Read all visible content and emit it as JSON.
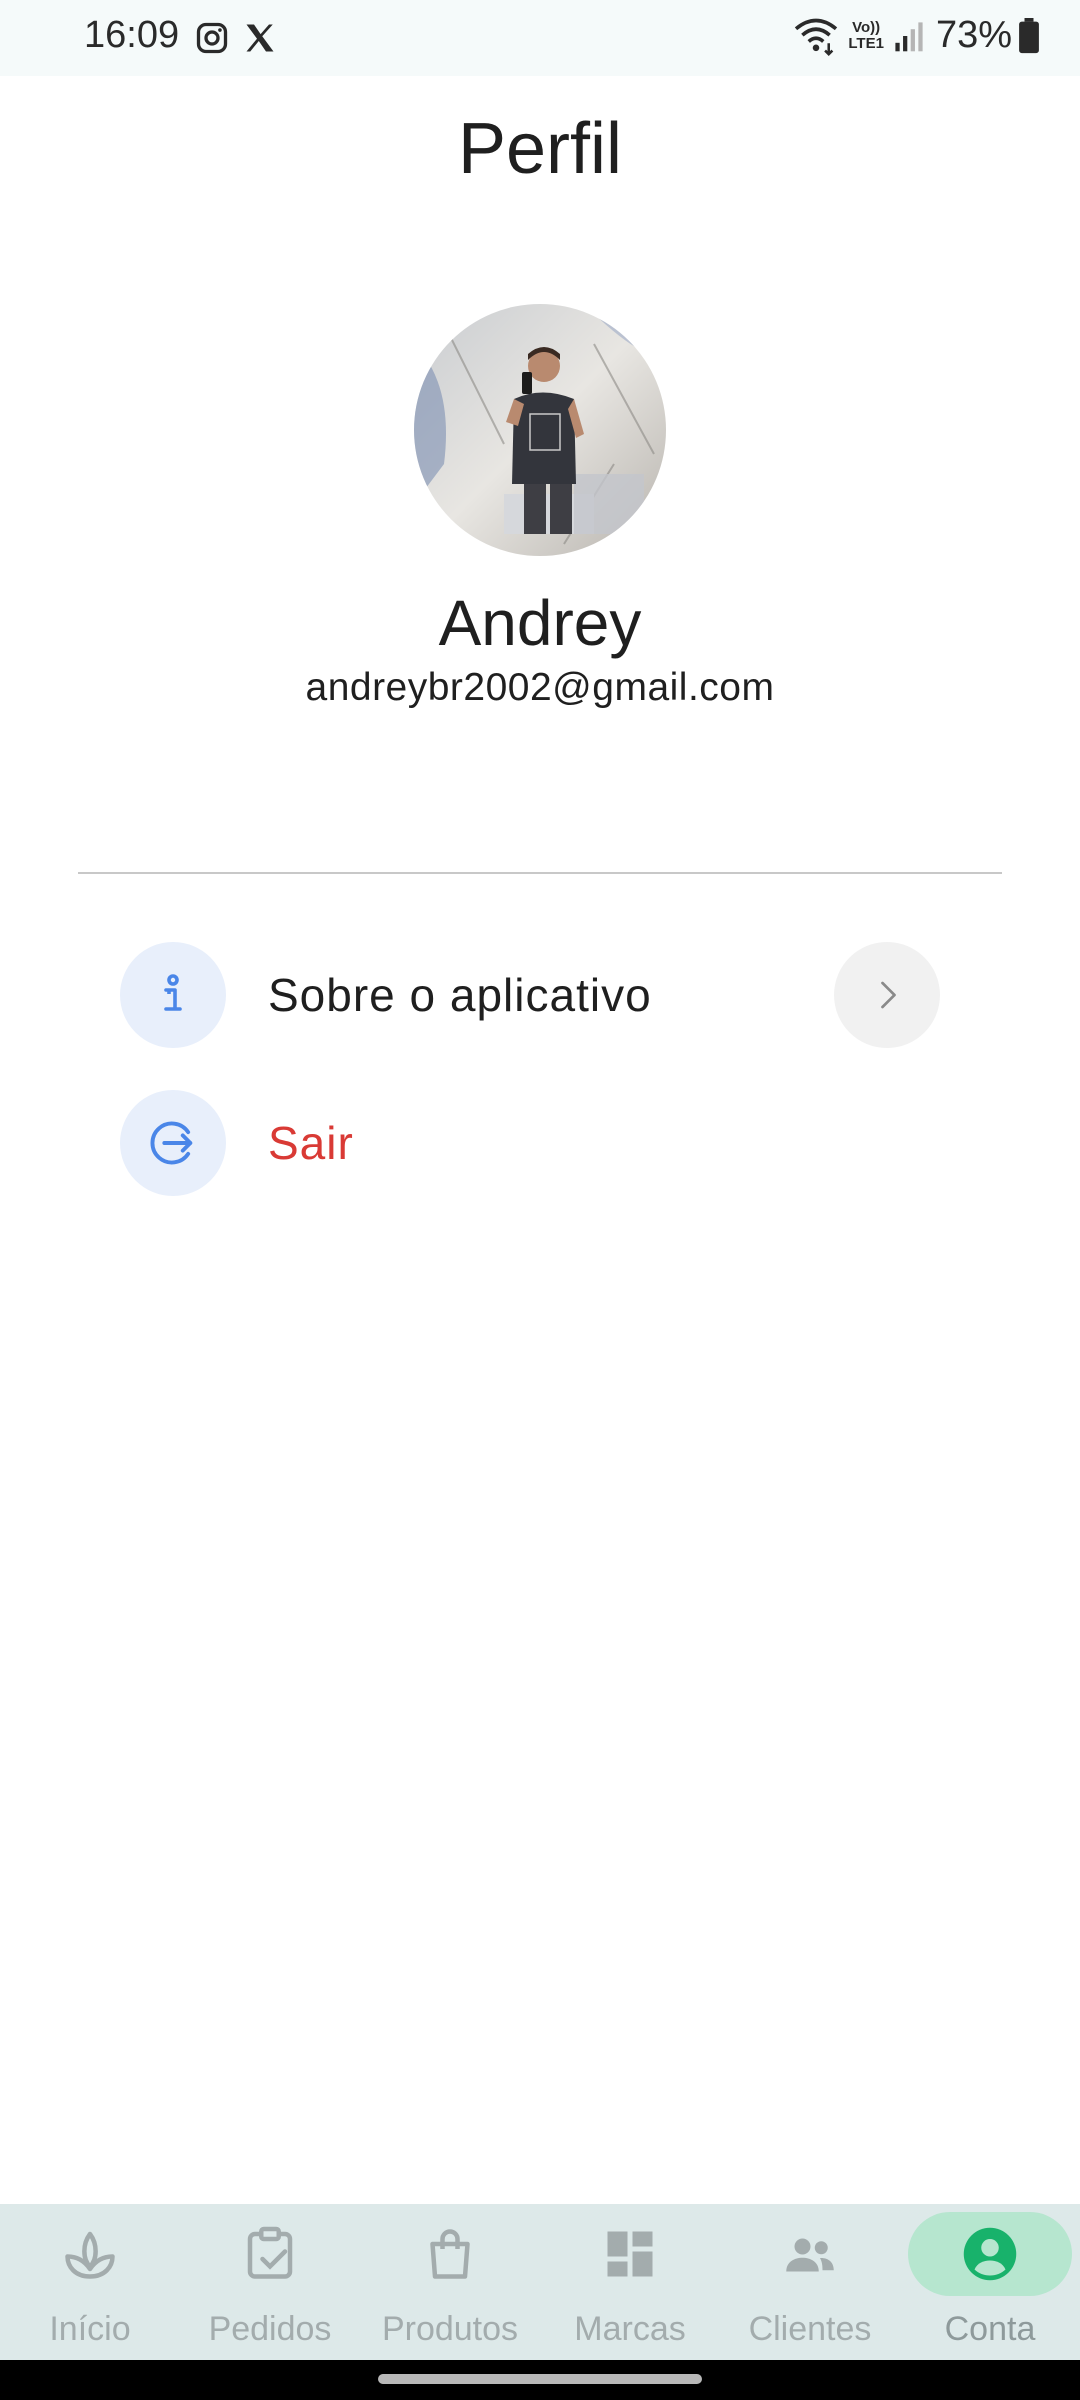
{
  "status_bar": {
    "time": "16:09",
    "battery": "73%",
    "volte_top": "Vo))",
    "volte_bottom": "LTE1",
    "icons": [
      "instagram-icon",
      "x-icon",
      "wifi-icon",
      "volte-icon",
      "signal-icon",
      "battery-icon"
    ]
  },
  "page": {
    "title": "Perfil"
  },
  "profile": {
    "name": "Andrey",
    "email": "andreybr2002@gmail.com"
  },
  "menu": [
    {
      "label": "Sobre o aplicativo",
      "icon": "info-icon",
      "color": "#1f1f1f"
    },
    {
      "label": "Sair",
      "icon": "logout-icon",
      "color": "#d93a35"
    }
  ],
  "colors": {
    "accent": "#4a86e8",
    "danger": "#d93a35",
    "nav_active": "#18b26b",
    "nav_background": "#dde9e9"
  },
  "bottom_nav": [
    {
      "label": "Início",
      "icon": "plant-icon",
      "active": false
    },
    {
      "label": "Pedidos",
      "icon": "clipboard-check-icon",
      "active": false
    },
    {
      "label": "Produtos",
      "icon": "shopping-bag-icon",
      "active": false
    },
    {
      "label": "Marcas",
      "icon": "dashboard-icon",
      "active": false
    },
    {
      "label": "Clientes",
      "icon": "people-icon",
      "active": false
    },
    {
      "label": "Conta",
      "icon": "account-circle-icon",
      "active": true
    }
  ]
}
